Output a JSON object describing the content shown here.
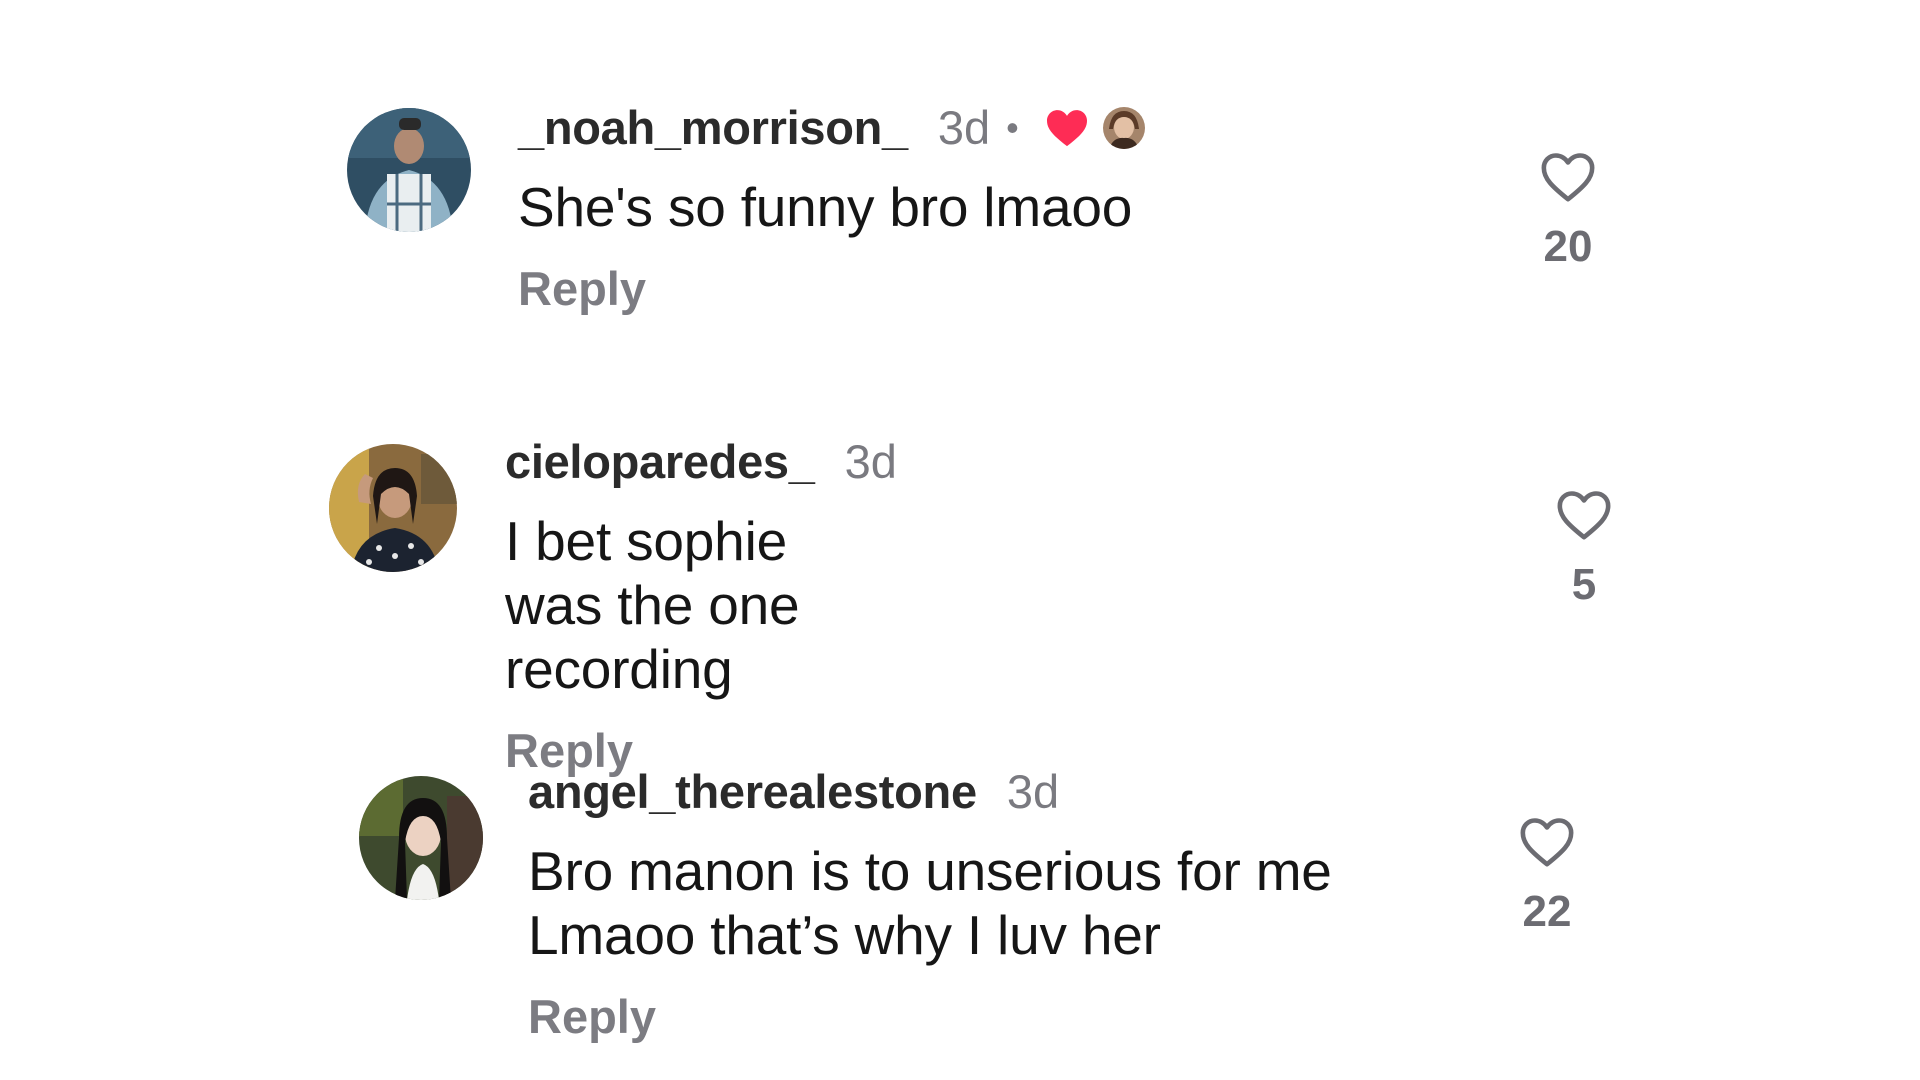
{
  "comments": [
    {
      "username": "_noah_morrison_",
      "time": "3d",
      "separator": "•",
      "liked_by_creator": true,
      "text": "She's so funny bro lmaoo",
      "reply_label": "Reply",
      "likes": "20"
    },
    {
      "username": "cieloparedes_",
      "time": "3d",
      "liked_by_creator": false,
      "text": "I bet sophie was the one recording",
      "reply_label": "Reply",
      "likes": "5"
    },
    {
      "username": "angel_therealestone",
      "time": "3d",
      "liked_by_creator": false,
      "text": "Bro manon is to unserious for me Lmaoo that’s why I luv her",
      "reply_label": "Reply",
      "likes": "22"
    }
  ],
  "colors": {
    "creator_heart": "#fe2c55",
    "username": "#2b2b2b",
    "secondary": "#7a7a80"
  },
  "icons": {
    "like": "heart-outline-icon",
    "creator_like": "heart-filled-icon"
  }
}
